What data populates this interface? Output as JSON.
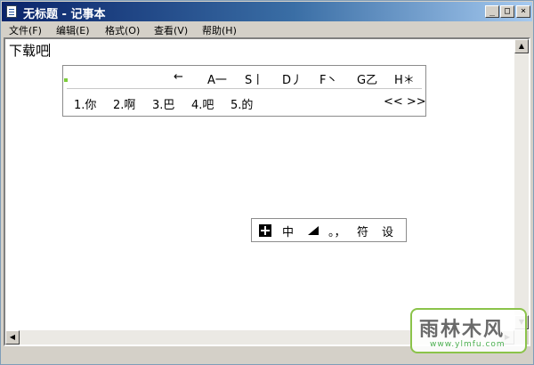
{
  "window": {
    "title": "无标题 - 记事本",
    "controls": {
      "minimize": "_",
      "maximize": "□",
      "close": "×"
    }
  },
  "menu": {
    "items": [
      {
        "label": "文件(F)"
      },
      {
        "label": "编辑(E)"
      },
      {
        "label": "格式(O)"
      },
      {
        "label": "查看(V)"
      },
      {
        "label": "帮助(H)"
      }
    ]
  },
  "editor": {
    "content": "下载吧"
  },
  "ime": {
    "radical_keys": [
      "←",
      "A一",
      "S丨",
      "D丿",
      "F丶",
      "G乙",
      "H＊"
    ],
    "candidates": [
      "1.你",
      "2.啊",
      "3.巴",
      "4.吧",
      "5.的"
    ],
    "pager": "<< >>"
  },
  "ime_status": {
    "mode": "中",
    "punctuation": "。，",
    "symbols": "符",
    "settings": "设"
  },
  "watermark": {
    "name": "雨林木风",
    "url": "www.ylmfu.com"
  },
  "colors": {
    "titlebar_start": "#0a246a",
    "titlebar_end": "#a6caf0",
    "watermark_border": "#8bc34a"
  }
}
